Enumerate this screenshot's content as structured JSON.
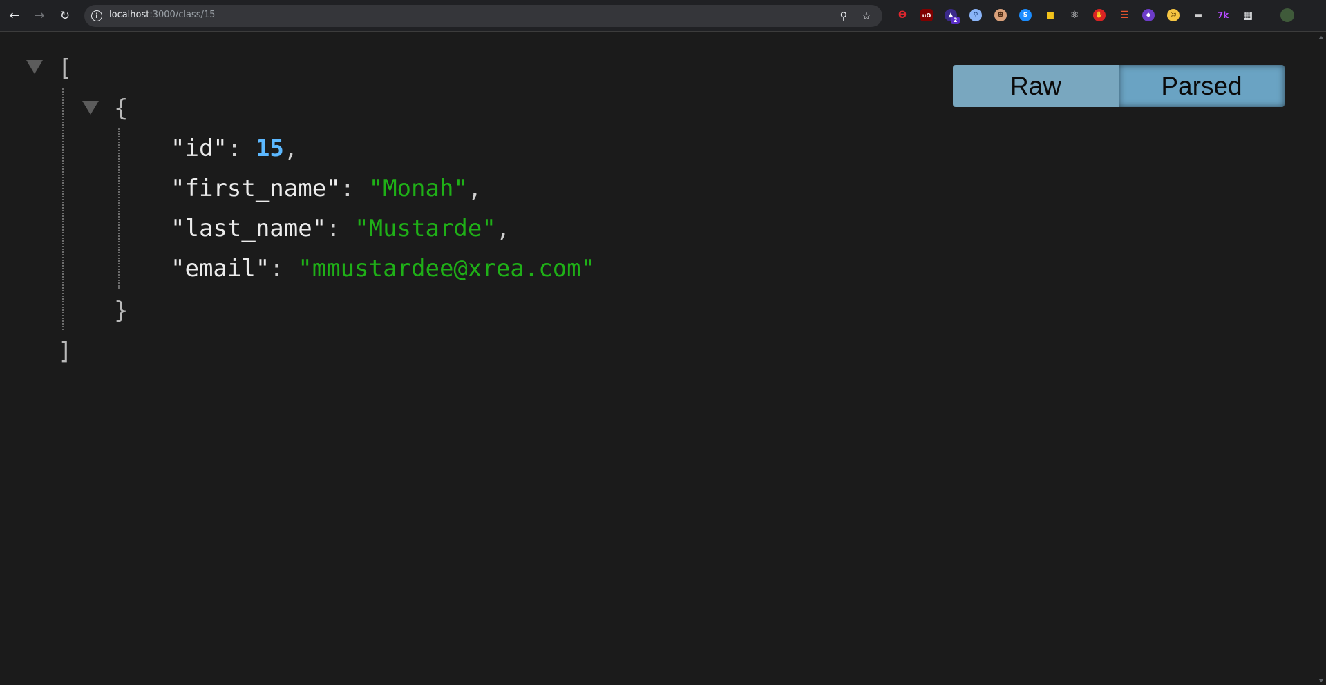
{
  "browser": {
    "url_host": "localhost",
    "url_rest": ":3000/class/15",
    "extensions": [
      "octopus-icon",
      "ublock-icon",
      "wizard-icon",
      "search-ext-icon",
      "face-icon",
      "shazam-icon",
      "lock-icon",
      "react-icon",
      "stop-icon",
      "layers-icon",
      "shield-icon",
      "emoji-icon",
      "hat-icon",
      "tailwind-icon",
      "puzzle-icon"
    ],
    "extension_badge": "2"
  },
  "json_viewer": {
    "open_bracket": "[",
    "close_bracket": "]",
    "open_brace": "{",
    "close_brace": "}",
    "fields": [
      {
        "key": "\"id\"",
        "value": "15",
        "type": "number",
        "comma": ","
      },
      {
        "key": "\"first_name\"",
        "value": "\"Monah\"",
        "type": "string",
        "comma": ","
      },
      {
        "key": "\"last_name\"",
        "value": "\"Mustarde\"",
        "type": "string",
        "comma": ","
      },
      {
        "key": "\"email\"",
        "value": "\"mmustardee@xrea.com\"",
        "type": "string",
        "comma": ""
      }
    ],
    "colon": ": "
  },
  "view_toggle": {
    "raw_label": "Raw",
    "parsed_label": "Parsed",
    "selected": "Parsed"
  },
  "colors": {
    "background": "#1b1b1b",
    "number": "#5cb8ff",
    "string": "#1fb017",
    "toggle": "#79a7bf"
  }
}
